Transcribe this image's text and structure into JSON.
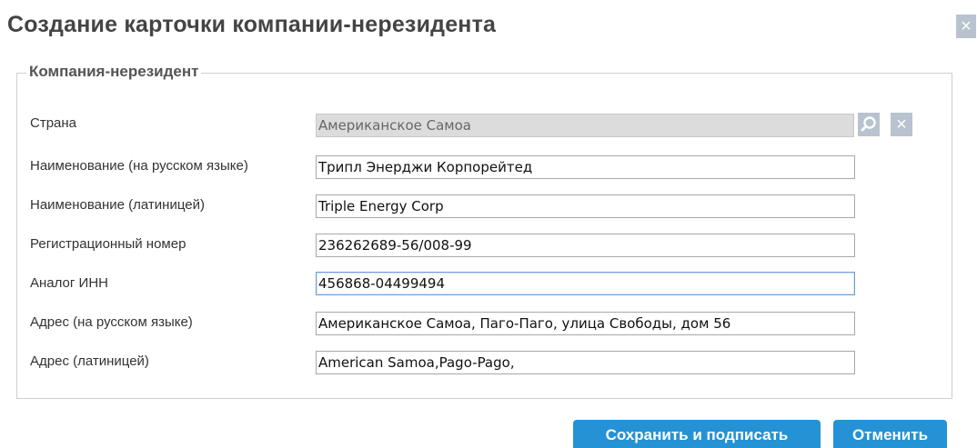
{
  "dialog": {
    "title": "Создание карточки компании-нерезидента",
    "close_glyph": "×"
  },
  "fieldset": {
    "legend": "Компания-нерезидент"
  },
  "form": {
    "country": {
      "label": "Страна",
      "value": "Американское Самоа",
      "search_icon": "search-icon",
      "clear_icon": "close-icon",
      "clear_glyph": "×"
    },
    "name_ru": {
      "label": "Наименование (на русском языке)",
      "value": "Трипл Энерджи Корпорейтед"
    },
    "name_lat": {
      "label": "Наименование (латиницей)",
      "value": "Triple Energy Corp"
    },
    "reg_number": {
      "label": "Регистрационный номер",
      "value": "236262689-56/008-99"
    },
    "inn_analog": {
      "label": "Аналог ИНН",
      "value": "456868-04499494"
    },
    "address_ru": {
      "label": "Адрес (на русском языке)",
      "value": "Американское Самоа, Паго-Паго, улица Свободы, дом 56"
    },
    "address_lat": {
      "label": "Адрес (латиницей)",
      "value": "American Samoa,Pago-Pago,"
    }
  },
  "actions": {
    "save_sign_label": "Сохранить и подписать",
    "cancel_label": "Отменить"
  },
  "colors": {
    "accent": "#2492d4",
    "icon_button": "#b8c3cf",
    "title_text": "#444444",
    "focus_border": "#6aa0d8"
  }
}
